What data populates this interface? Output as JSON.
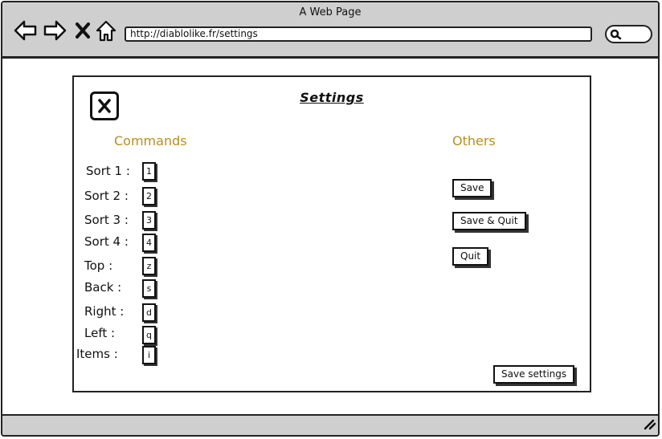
{
  "window": {
    "title": "A Web Page"
  },
  "browser": {
    "url": "http://diablolike.fr/settings",
    "icons": [
      "back-arrow-icon",
      "forward-arrow-icon",
      "close-x-icon",
      "home-icon",
      "search-icon",
      "resize-grip-icon"
    ]
  },
  "settings": {
    "title": "Settings",
    "close_icon": "close-x-icon",
    "commands_heading": "Commands",
    "others_heading": "Others",
    "heading_color": "#b88f18",
    "commands": [
      {
        "label": "Sort 1 :",
        "key": "1"
      },
      {
        "label": "Sort 2 :",
        "key": "2"
      },
      {
        "label": "Sort 3 :",
        "key": "3"
      },
      {
        "label": "Sort 4 :",
        "key": "4"
      },
      {
        "label": "Top :",
        "key": "z"
      },
      {
        "label": "Back :",
        "key": "s"
      },
      {
        "label": "Right :",
        "key": "d"
      },
      {
        "label": "Left :",
        "key": "q"
      },
      {
        "label": "Items :",
        "key": "i"
      }
    ],
    "buttons": {
      "save": "Save",
      "save_quit": "Save & Quit",
      "quit": "Quit",
      "save_settings": "Save settings"
    }
  }
}
